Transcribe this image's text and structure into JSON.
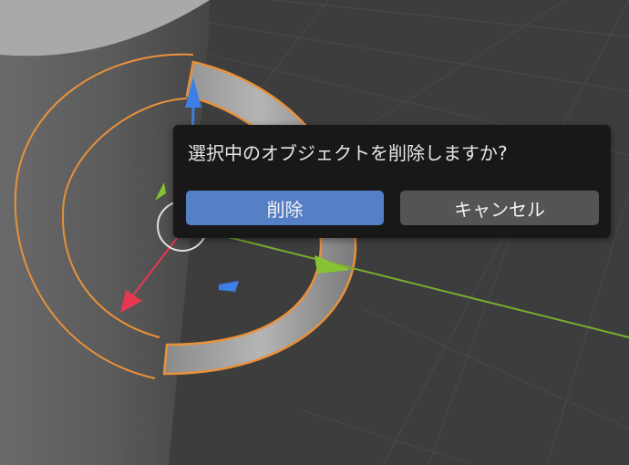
{
  "dialog": {
    "message": "選択中のオブジェクトを削除しますか?",
    "confirm_label": "削除",
    "cancel_label": "キャンセル"
  },
  "colors": {
    "viewport_background": "#3d3d3d",
    "grid_line": "#4a4a4a",
    "selection_outline": "#e8913a",
    "x_axis": "#7ab02c",
    "y_axis_handle": "#e8384f",
    "z_axis_handle": "#3d7fe6",
    "dialog_background": "#181818",
    "confirm_button": "#5580c6",
    "cancel_button": "#545454"
  }
}
